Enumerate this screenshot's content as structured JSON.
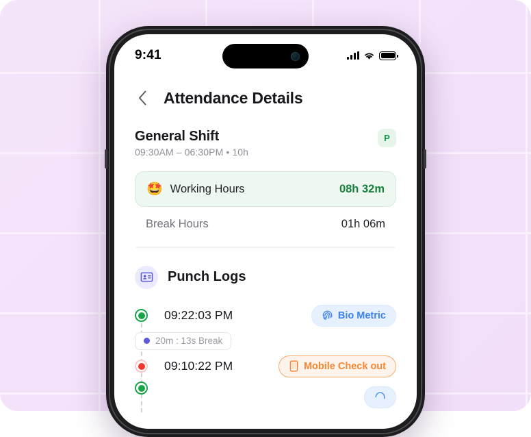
{
  "status_bar": {
    "time": "9:41",
    "cellular_icon": "signal-bars-icon",
    "wifi_icon": "wifi-icon",
    "battery_icon": "battery-full-icon"
  },
  "nav": {
    "back_icon": "chevron-left-icon",
    "title": "Attendance Details"
  },
  "shift": {
    "name": "General Shift",
    "schedule": "09:30AM – 06:30PM • 10h",
    "status_badge": "P"
  },
  "summary": {
    "working": {
      "emoji": "🤩",
      "label": "Working Hours",
      "value": "08h 32m"
    },
    "break": {
      "label": "Break Hours",
      "value": "01h 06m"
    }
  },
  "punch_logs": {
    "icon": "id-badge-icon",
    "title": "Punch Logs",
    "entries": [
      {
        "time": "09:22:03 PM",
        "dot": "green",
        "chip_label": "Bio Metric",
        "chip_icon": "fingerprint-icon",
        "chip_color": "blue"
      },
      {
        "time": "09:10:22 PM",
        "dot": "red",
        "chip_label": "Mobile Check out",
        "chip_icon": "mobile-phone-icon",
        "chip_color": "orange"
      }
    ],
    "break_marker": {
      "label": "20m : 13s Break",
      "dot_color": "#5b5bd6"
    }
  },
  "colors": {
    "accent_green": "#17803d",
    "accent_blue": "#3b82f6",
    "accent_orange": "#f58634",
    "accent_purple": "#5b5bd6",
    "background": "#f3e1f9"
  }
}
